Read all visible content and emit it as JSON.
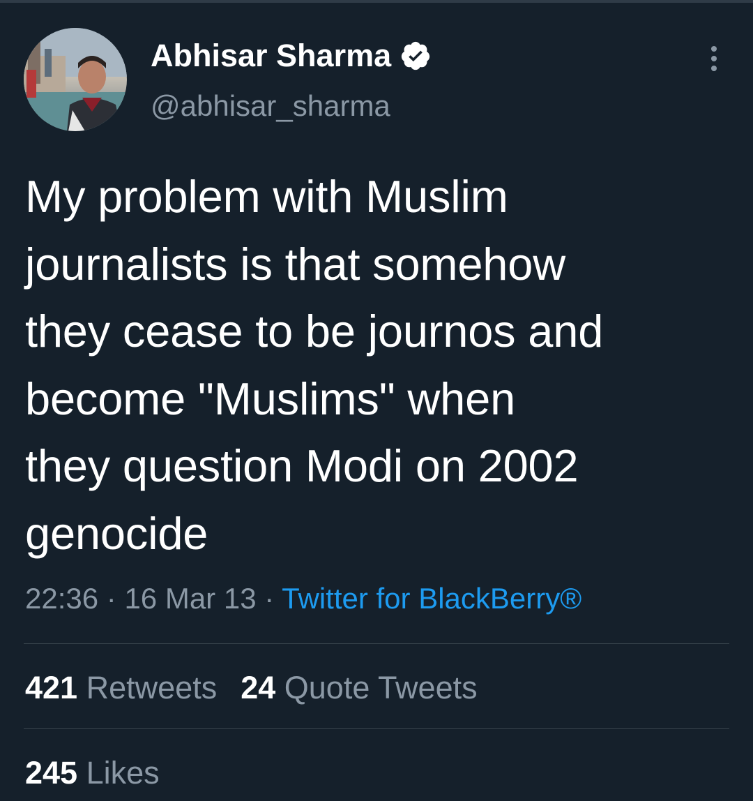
{
  "tweet": {
    "author": {
      "display_name": "Abhisar Sharma",
      "handle": "@abhisar_sharma",
      "verified": true
    },
    "text": "My problem with Muslim\njournalists is that somehow\nthey cease to be journos and\nbecome \"Muslims\" when\nthey question Modi on 2002\ngenocide",
    "meta": {
      "time": "22:36",
      "separator": "·",
      "date": "16 Mar 13",
      "source": "Twitter for BlackBerry®"
    },
    "stats": {
      "retweets_count": "421",
      "retweets_label": "Retweets",
      "quotes_count": "24",
      "quotes_label": "Quote Tweets",
      "likes_count": "245",
      "likes_label": "Likes"
    }
  },
  "colors": {
    "background": "#15202b",
    "text": "#ffffff",
    "secondary": "#8b98a5",
    "link": "#1d9bf0",
    "divider": "#38444d"
  },
  "icons": {
    "verified": "verified-badge-icon",
    "more": "more-vertical-icon"
  }
}
